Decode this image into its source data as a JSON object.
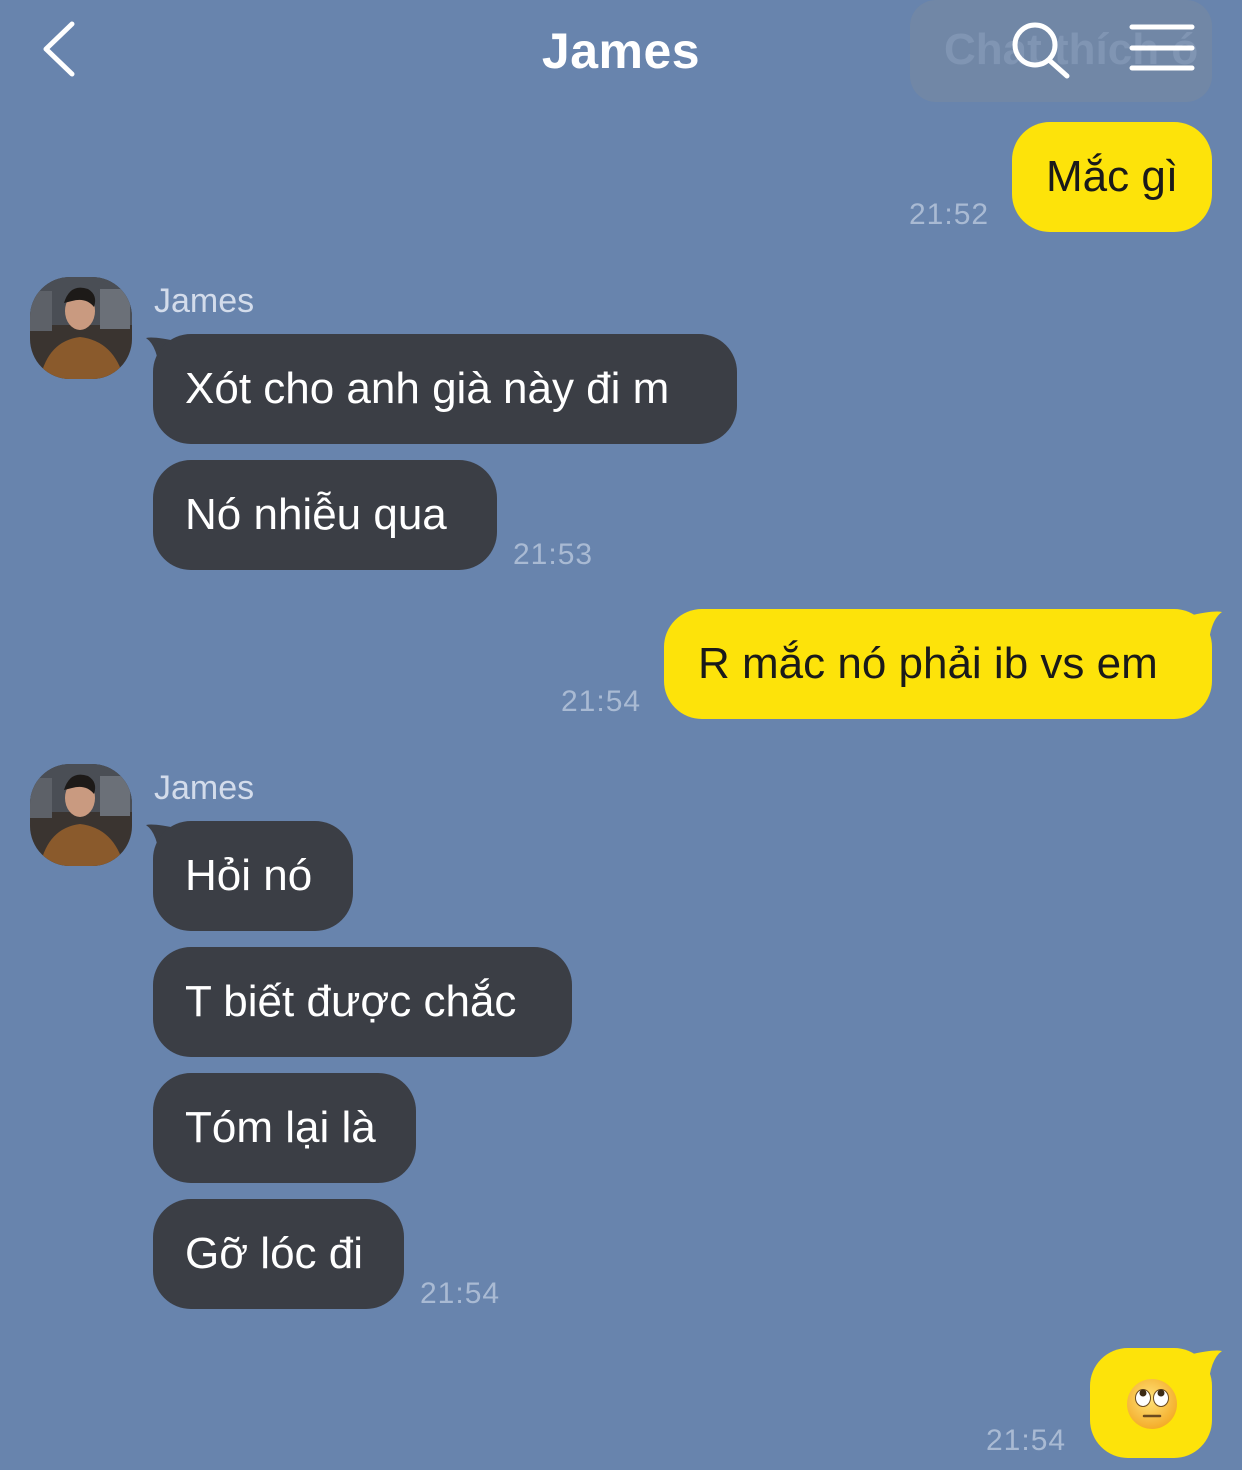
{
  "header": {
    "title": "James",
    "ghost_text": "Chat thích ó",
    "back_icon": "chevron-left-icon",
    "search_icon": "search-icon",
    "menu_icon": "hamburger-menu-icon"
  },
  "colors": {
    "background": "#6884ad",
    "incoming_bubble": "#3b3e45",
    "outgoing_bubble": "#fde30a",
    "timestamp": "#a9bad3"
  },
  "messages": [
    {
      "direction": "out",
      "text": "Mắc gì",
      "time": "21:52"
    },
    {
      "direction": "in",
      "sender": "James",
      "text": "Xót cho anh già này đi m"
    },
    {
      "direction": "in",
      "text": "Nó nhiễu qua",
      "time": "21:53"
    },
    {
      "direction": "out",
      "text": "R mắc nó phải ib vs em",
      "time": "21:54"
    },
    {
      "direction": "in",
      "sender": "James",
      "text": "Hỏi nó"
    },
    {
      "direction": "in",
      "text": "T biết được chắc"
    },
    {
      "direction": "in",
      "text": "Tóm lại là"
    },
    {
      "direction": "in",
      "text": "Gỡ lóc đi",
      "time": "21:54"
    },
    {
      "direction": "out",
      "emoji": "face-with-rolling-eyes-emoji",
      "time": "21:54"
    }
  ]
}
